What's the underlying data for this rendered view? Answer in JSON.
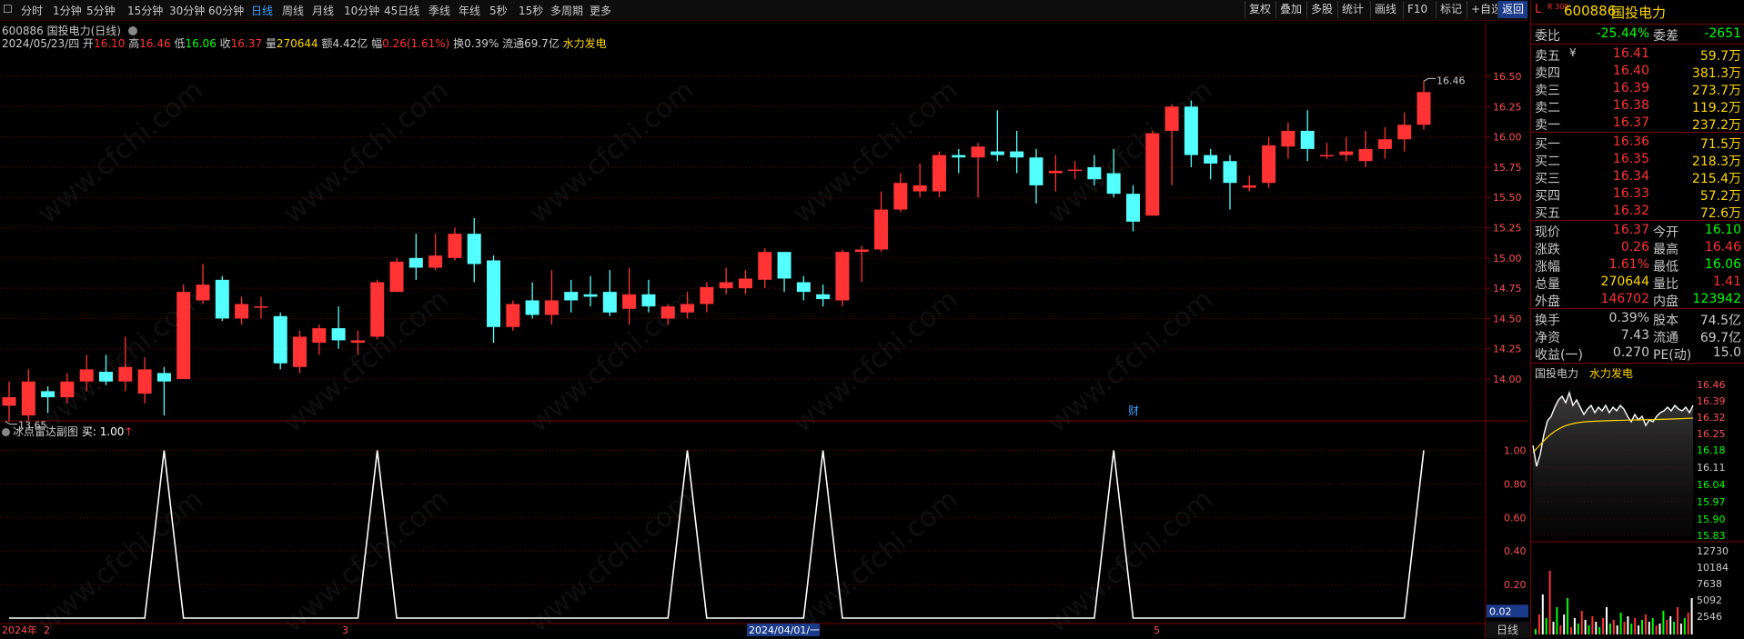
{
  "toolbar": {
    "periods": [
      "分时",
      "1分钟",
      "5分钟",
      "15分钟",
      "30分钟",
      "60分钟",
      "日线",
      "周线",
      "月线",
      "10分钟",
      "45日线",
      "季线",
      "年线",
      "5秒",
      "15秒",
      "多周期",
      "更多"
    ],
    "active_period": "日线",
    "right_buttons": [
      "复权",
      "叠加",
      "多股",
      "统计",
      "画线",
      "F10",
      "标记",
      "+自选",
      "返回"
    ],
    "active_right": "返回"
  },
  "header": {
    "title": "600886 国投电力(日线)",
    "date": "2024/05/23/四",
    "open_label": "开",
    "open": "16.10",
    "high_label": "高",
    "high": "16.46",
    "low_label": "低",
    "low": "16.06",
    "close_label": "收",
    "close": "16.37",
    "vol_label": "量",
    "vol": "270644",
    "amount_label": "额",
    "amount": "4.42亿",
    "chg_label": "幅",
    "chg": "0.26(1.61%)",
    "turnover": "换0.39%",
    "float_cap": "流通69.7亿",
    "sector": "水力发电"
  },
  "chart_data": [
    {
      "type": "candlestick",
      "title": "600886 国投电力(日线)",
      "ylim": [
        13.55,
        16.65
      ],
      "yticks": [
        "16.50",
        "16.25",
        "16.00",
        "15.75",
        "15.50",
        "15.25",
        "15.00",
        "14.75",
        "14.50",
        "14.25",
        "14.00"
      ],
      "ytick_values": [
        16.5,
        16.25,
        16.0,
        15.75,
        15.5,
        15.25,
        15.0,
        14.75,
        14.5,
        14.25,
        14.0
      ],
      "max_label": "16.46",
      "min_label": "13.65",
      "annotation": "财",
      "candles": [
        [
          13.78,
          13.85,
          13.65,
          13.98
        ],
        [
          13.7,
          13.98,
          13.66,
          14.08
        ],
        [
          13.9,
          13.85,
          13.72,
          13.94
        ],
        [
          13.85,
          13.98,
          13.8,
          14.05
        ],
        [
          13.98,
          14.08,
          13.9,
          14.2
        ],
        [
          14.06,
          13.98,
          13.95,
          14.2
        ],
        [
          13.98,
          14.1,
          13.9,
          14.35
        ],
        [
          13.88,
          14.08,
          13.8,
          14.18
        ],
        [
          14.05,
          13.98,
          13.7,
          14.1
        ],
        [
          14.0,
          14.72,
          14.0,
          14.78
        ],
        [
          14.65,
          14.78,
          14.62,
          14.95
        ],
        [
          14.82,
          14.5,
          14.48,
          14.85
        ],
        [
          14.5,
          14.62,
          14.45,
          14.68
        ],
        [
          14.6,
          14.6,
          14.5,
          14.68
        ],
        [
          14.52,
          14.13,
          14.08,
          14.55
        ],
        [
          14.1,
          14.35,
          14.05,
          14.4
        ],
        [
          14.3,
          14.42,
          14.2,
          14.45
        ],
        [
          14.42,
          14.32,
          14.25,
          14.6
        ],
        [
          14.3,
          14.32,
          14.2,
          14.4
        ],
        [
          14.35,
          14.8,
          14.33,
          14.82
        ],
        [
          14.72,
          14.97,
          14.72,
          15.0
        ],
        [
          15.0,
          14.92,
          14.82,
          15.2
        ],
        [
          14.92,
          15.02,
          14.9,
          15.2
        ],
        [
          15.0,
          15.2,
          14.98,
          15.25
        ],
        [
          15.2,
          14.95,
          14.8,
          15.33
        ],
        [
          14.98,
          14.43,
          14.3,
          15.02
        ],
        [
          14.43,
          14.62,
          14.4,
          14.65
        ],
        [
          14.65,
          14.53,
          14.5,
          14.8
        ],
        [
          14.53,
          14.65,
          14.45,
          14.9
        ],
        [
          14.72,
          14.65,
          14.55,
          14.82
        ],
        [
          14.7,
          14.68,
          14.6,
          14.85
        ],
        [
          14.72,
          14.55,
          14.52,
          14.9
        ],
        [
          14.58,
          14.7,
          14.45,
          14.92
        ],
        [
          14.7,
          14.6,
          14.55,
          14.82
        ],
        [
          14.5,
          14.6,
          14.45,
          14.62
        ],
        [
          14.55,
          14.62,
          14.5,
          14.72
        ],
        [
          14.62,
          14.76,
          14.55,
          14.8
        ],
        [
          14.75,
          14.8,
          14.7,
          14.92
        ],
        [
          14.75,
          14.83,
          14.7,
          14.9
        ],
        [
          14.82,
          15.05,
          14.75,
          15.08
        ],
        [
          15.05,
          14.83,
          14.72,
          15.05
        ],
        [
          14.8,
          14.72,
          14.65,
          14.85
        ],
        [
          14.7,
          14.66,
          14.6,
          14.78
        ],
        [
          14.65,
          15.05,
          14.6,
          15.07
        ],
        [
          15.05,
          15.07,
          14.8,
          15.1
        ],
        [
          15.07,
          15.4,
          15.05,
          15.55
        ],
        [
          15.4,
          15.62,
          15.38,
          15.7
        ],
        [
          15.55,
          15.6,
          15.5,
          15.78
        ],
        [
          15.55,
          15.85,
          15.5,
          15.88
        ],
        [
          15.85,
          15.83,
          15.7,
          15.9
        ],
        [
          15.83,
          15.92,
          15.5,
          15.95
        ],
        [
          15.88,
          15.85,
          15.8,
          16.22
        ],
        [
          15.88,
          15.83,
          15.7,
          16.05
        ],
        [
          15.83,
          15.6,
          15.45,
          15.9
        ],
        [
          15.7,
          15.72,
          15.55,
          15.85
        ],
        [
          15.72,
          15.73,
          15.65,
          15.8
        ],
        [
          15.75,
          15.65,
          15.6,
          15.85
        ],
        [
          15.7,
          15.53,
          15.5,
          15.9
        ],
        [
          15.53,
          15.3,
          15.22,
          15.6
        ],
        [
          15.35,
          16.03,
          15.35,
          16.05
        ],
        [
          16.05,
          16.25,
          15.6,
          16.27
        ],
        [
          16.25,
          15.85,
          15.75,
          16.3
        ],
        [
          15.85,
          15.78,
          15.65,
          15.9
        ],
        [
          15.8,
          15.62,
          15.4,
          15.85
        ],
        [
          15.58,
          15.6,
          15.55,
          15.68
        ],
        [
          15.62,
          15.93,
          15.58,
          16.0
        ],
        [
          15.92,
          16.05,
          15.82,
          16.12
        ],
        [
          16.05,
          15.9,
          15.8,
          16.22
        ],
        [
          15.85,
          15.85,
          15.82,
          15.95
        ],
        [
          15.85,
          15.88,
          15.8,
          16.0
        ],
        [
          15.8,
          15.9,
          15.75,
          16.05
        ],
        [
          15.9,
          15.98,
          15.82,
          16.08
        ],
        [
          15.98,
          16.1,
          15.88,
          16.2
        ],
        [
          16.1,
          16.37,
          16.06,
          16.46
        ]
      ]
    },
    {
      "type": "line",
      "title": "冰点雷达副图",
      "series_label": "买: 1.00",
      "ylim": [
        0,
        1.1
      ],
      "yticks": [
        "1.00",
        "0.80",
        "0.60",
        "0.40",
        "0.20"
      ],
      "ytick_values": [
        1.0,
        0.8,
        0.6,
        0.4,
        0.2
      ],
      "current_value": "0.02",
      "x_labels": [
        "2024年",
        "2",
        "3",
        "2024/04/01/一",
        "5"
      ],
      "x_count": 74,
      "pulses": [
        8,
        19,
        35,
        42,
        57,
        73
      ]
    }
  ],
  "right_panel": {
    "market_tag": "L",
    "index_tag": "R 300",
    "code": "600886",
    "name": "国投电力",
    "webi_label": "委比",
    "webi_value": "-25.44%",
    "wecha_label": "委差",
    "wecha_value": "-2651",
    "asks": [
      {
        "label": "卖五",
        "price": "16.41",
        "vol": "59.7万"
      },
      {
        "label": "卖四",
        "price": "16.40",
        "vol": "381.3万"
      },
      {
        "label": "卖三",
        "price": "16.39",
        "vol": "273.7万"
      },
      {
        "label": "卖二",
        "price": "16.38",
        "vol": "119.2万"
      },
      {
        "label": "卖一",
        "price": "16.37",
        "vol": "237.2万"
      }
    ],
    "bids": [
      {
        "label": "买一",
        "price": "16.36",
        "vol": "71.5万"
      },
      {
        "label": "买二",
        "price": "16.35",
        "vol": "218.3万"
      },
      {
        "label": "买三",
        "price": "16.34",
        "vol": "215.4万"
      },
      {
        "label": "买四",
        "price": "16.33",
        "vol": "57.2万"
      },
      {
        "label": "买五",
        "price": "16.32",
        "vol": "72.6万"
      }
    ],
    "yen_mark": "¥",
    "stats": [
      {
        "l1": "现价",
        "v1": "16.37",
        "l2": "今开",
        "v2": "16.10"
      },
      {
        "l1": "涨跌",
        "v1": "0.26",
        "l2": "最高",
        "v2": "16.46"
      },
      {
        "l1": "涨幅",
        "v1": "1.61%",
        "l2": "最低",
        "v2": "16.06"
      },
      {
        "l1": "总量",
        "v1": "270644",
        "l2": "量比",
        "v2": "1.41"
      },
      {
        "l1": "外盘",
        "v1": "146702",
        "l2": "内盘",
        "v2": "123942"
      }
    ],
    "stats2": [
      {
        "l1": "换手",
        "v1": "0.39%",
        "l2": "股本",
        "v2": "74.5亿"
      },
      {
        "l1": "净资",
        "v1": "7.43",
        "l2": "流通",
        "v2": "69.7亿"
      },
      {
        "l1": "收益(一)",
        "v1": "0.270",
        "l2": "PE(动)",
        "v2": "15.0"
      }
    ],
    "mini": {
      "name": "国投电力",
      "sector": "水力发电",
      "price_ticks": [
        "16.46",
        "16.39",
        "16.32",
        "16.25",
        "16.18",
        "16.11",
        "16.04",
        "15.97",
        "15.90",
        "15.83"
      ],
      "vol_ticks": [
        "12730",
        "10184",
        "7638",
        "5092",
        "2546"
      ]
    }
  },
  "bottom": {
    "period_label": "日线"
  },
  "colors": {
    "up": "#ff3333",
    "down": "#54ffff",
    "grid": "#7a0000",
    "accent": "#3f9fff",
    "yellow": "#ffd700"
  },
  "watermark": "www.cfchi.com"
}
